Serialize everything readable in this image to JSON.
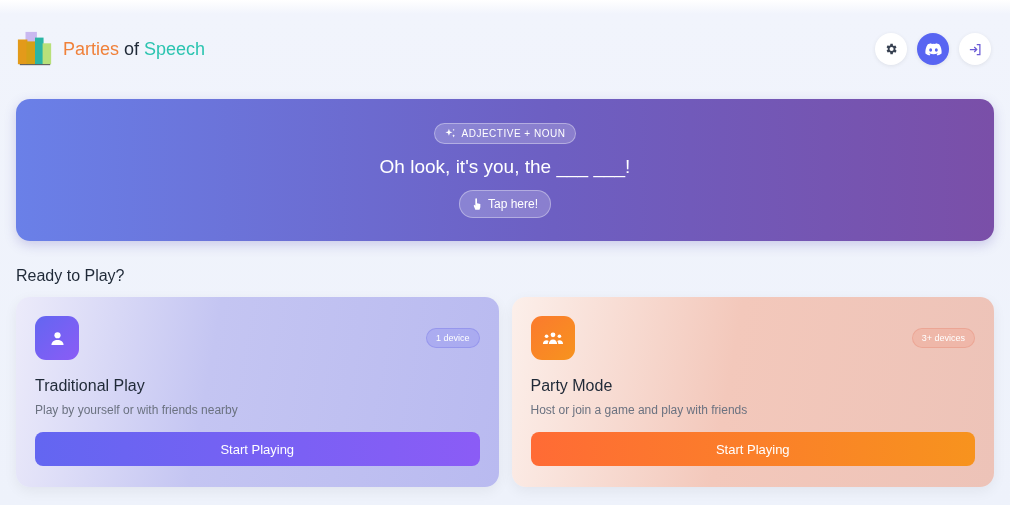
{
  "header": {
    "title_parts": [
      {
        "text": "Parties",
        "color": "#f0813a"
      },
      {
        "text": "of",
        "color": "#1f2937"
      },
      {
        "text": "Speech",
        "color": "#2cc4b0"
      }
    ],
    "actions": [
      {
        "kind": "settings"
      },
      {
        "kind": "discord"
      },
      {
        "kind": "login"
      }
    ]
  },
  "banner": {
    "tag": "ADJECTIVE + NOUN",
    "prompt": "Oh look, it's you, the ___ ___!",
    "button": "Tap here!"
  },
  "section_title": "Ready to Play?",
  "modes": [
    {
      "kind": "solo",
      "title": "Traditional Play",
      "badge": "1 device",
      "description": "Play by yourself or with friends nearby",
      "button": "Start Playing"
    },
    {
      "kind": "party",
      "title": "Party Mode",
      "badge": "3+ devices",
      "description": "Host or join a game and play with friends",
      "button": "Start Playing"
    }
  ]
}
